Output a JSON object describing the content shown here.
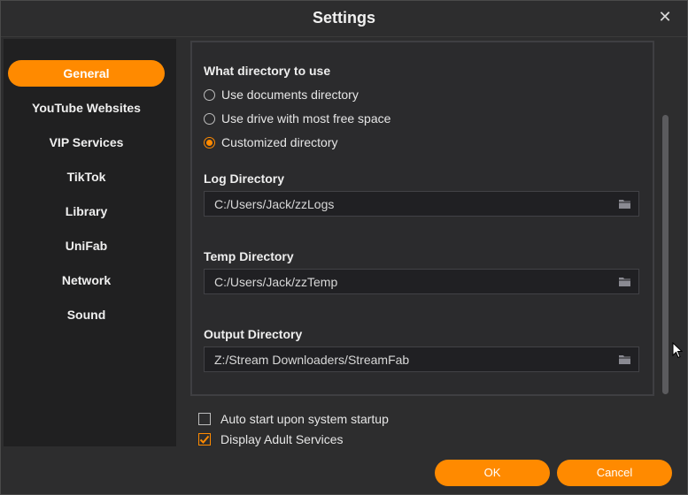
{
  "window": {
    "title": "Settings"
  },
  "sidebar": {
    "items": [
      {
        "label": "General",
        "active": true
      },
      {
        "label": "YouTube Websites"
      },
      {
        "label": "VIP Services"
      },
      {
        "label": "TikTok"
      },
      {
        "label": "Library"
      },
      {
        "label": "UniFab"
      },
      {
        "label": "Network"
      },
      {
        "label": "Sound"
      }
    ]
  },
  "general": {
    "directory_heading": "What directory to use",
    "directory_options": [
      {
        "label": "Use documents directory",
        "checked": false
      },
      {
        "label": "Use drive with most free space",
        "checked": false
      },
      {
        "label": "Customized directory",
        "checked": true
      }
    ],
    "log": {
      "label": "Log Directory",
      "value": "C:/Users/Jack/zzLogs"
    },
    "temp": {
      "label": "Temp Directory",
      "value": "C:/Users/Jack/zzTemp"
    },
    "output": {
      "label": "Output Directory",
      "value": "Z:/Stream Downloaders/StreamFab"
    },
    "auto_start": {
      "label": "Auto start upon system startup",
      "checked": false
    },
    "adult": {
      "label": "Display Adult Services",
      "checked": true
    }
  },
  "footer": {
    "ok_label": "OK",
    "cancel_label": "Cancel"
  },
  "colors": {
    "accent": "#ff8a00",
    "sidebar_bg": "#202021",
    "window_bg": "#2d2d2e"
  }
}
